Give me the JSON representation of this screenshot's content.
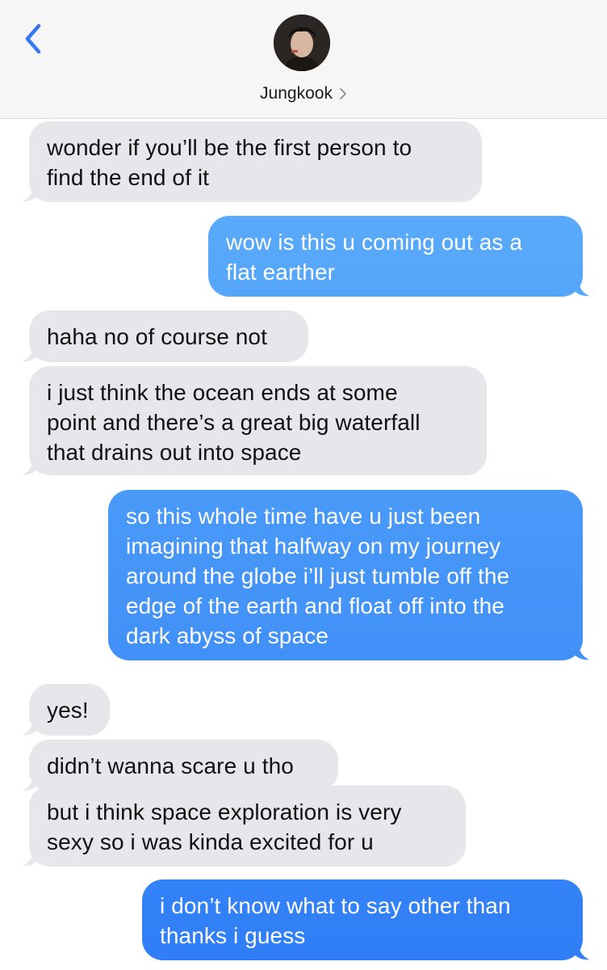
{
  "header": {
    "contact_name": "Jungkook",
    "back_icon": "chevron-left-icon",
    "accent_color": "#3478f6"
  },
  "messages": [
    {
      "dir": "in",
      "lines": [
        "wonder if you’ll be the first person to",
        "find the end of it"
      ]
    },
    {
      "dir": "out",
      "lines": [
        "wow is this u coming out as a",
        "flat earther"
      ]
    },
    {
      "dir": "in",
      "lines": [
        "haha no of course not"
      ]
    },
    {
      "dir": "in",
      "lines": [
        "i just think the ocean ends at some",
        "point and there’s a great big waterfall",
        "that drains out into space"
      ]
    },
    {
      "dir": "out",
      "lines": [
        "so this whole time have u just been",
        "imagining that halfway on my journey",
        "around the globe i’ll just tumble off the",
        "edge of the earth and float off into the",
        "dark abyss of space"
      ]
    },
    {
      "dir": "in",
      "lines": [
        "yes!"
      ]
    },
    {
      "dir": "in",
      "lines": [
        "didn’t wanna scare u tho"
      ]
    },
    {
      "dir": "in",
      "lines": [
        "but i think space exploration is very",
        "sexy so i was kinda excited for u"
      ]
    },
    {
      "dir": "out",
      "lines": [
        "i don’t know what to say other than",
        "thanks i guess"
      ]
    }
  ],
  "colors": {
    "incoming_bubble": "#e6e6eb",
    "outgoing_gradient_light": "#5fb0fb",
    "outgoing_gradient_dark": "#2f7df6"
  }
}
